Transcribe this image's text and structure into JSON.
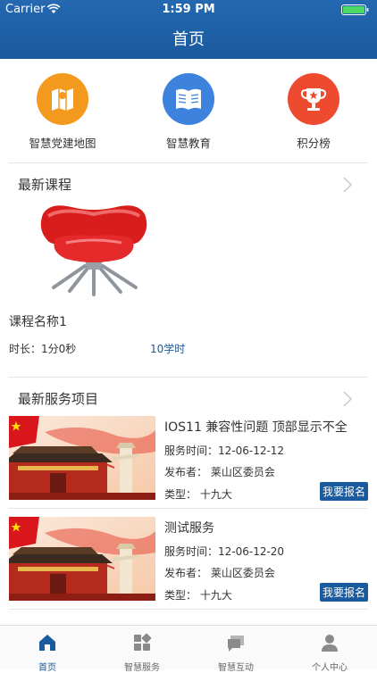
{
  "status_bar": {
    "carrier": "Carrier",
    "time": "1:59 PM"
  },
  "header": {
    "title": "首页"
  },
  "quick_actions": [
    {
      "label": "智慧党建地图",
      "icon": "map-icon",
      "color": "#f39a1e"
    },
    {
      "label": "智慧教育",
      "icon": "book-icon",
      "color": "#3d82dd"
    },
    {
      "label": "积分榜",
      "icon": "trophy-icon",
      "color": "#ee4a30"
    }
  ],
  "courses_section": {
    "title": "最新课程"
  },
  "course": {
    "name": "课程名称1",
    "duration": "时长：1分0秒",
    "hours": "10学时",
    "image": "red-chair-image"
  },
  "services_section": {
    "title": "最新服务项目"
  },
  "services": [
    {
      "title": "IOS11 兼容性问题  顶部显示不全",
      "time": "服务时间：12-06-12-12",
      "publisher": "发布者：  莱山区委员会",
      "type": "类型：  十九大",
      "button": "我要报名"
    },
    {
      "title": "测试服务",
      "time": "服务时间：12-06-12-20",
      "publisher": "发布者：  莱山区委员会",
      "type": "类型：  十九大",
      "button": "我要报名"
    }
  ],
  "tabbar": [
    {
      "label": "首页",
      "icon": "home-icon",
      "active": true
    },
    {
      "label": "智慧服务",
      "icon": "grid-icon",
      "active": false
    },
    {
      "label": "智慧互动",
      "icon": "chat-icon",
      "active": false
    },
    {
      "label": "个人中心",
      "icon": "person-icon",
      "active": false
    }
  ],
  "colors": {
    "primary": "#1a5a9e",
    "accent_orange": "#f39a1e",
    "accent_blue": "#3d82dd",
    "accent_red": "#ee4a30"
  }
}
